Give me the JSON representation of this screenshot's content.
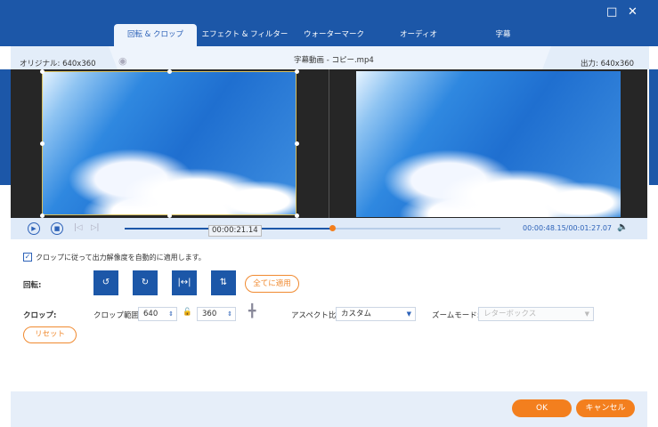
{
  "window": {
    "maximize_icon": "square-icon",
    "close_icon": "x-icon"
  },
  "tabs": [
    {
      "label": "回転 & クロップ",
      "active": true
    },
    {
      "label": "エフェクト & フィルター"
    },
    {
      "label": "ウォーターマーク"
    },
    {
      "label": "オーディオ"
    },
    {
      "label": "字幕"
    }
  ],
  "info": {
    "original": "オリジナル: 640x360",
    "filename": "字幕動画 - コピー.mp4",
    "output": "出力: 640x360"
  },
  "player": {
    "current_tooltip": "00:00:21.14",
    "time": "00:00:48.15/00:01:27.07",
    "progress": 0.553
  },
  "auto_apply": {
    "checked": true,
    "label": "クロップに従って出力解像度を自動的に適用します。"
  },
  "rotate": {
    "label": "回転:",
    "apply_all": "全てに適用"
  },
  "crop": {
    "label": "クロップ:",
    "range_label": "クロップ範囲:",
    "width": "640",
    "height": "360",
    "aspect_label": "アスペクト比:",
    "aspect_value": "カスタム",
    "zoom_label": "ズームモード:",
    "zoom_value": "レターボックス",
    "reset": "リセット"
  },
  "footer": {
    "ok": "OK",
    "cancel": "キャンセル"
  },
  "colors": {
    "brand": "#1c57a8",
    "accent": "#f37f1e"
  }
}
